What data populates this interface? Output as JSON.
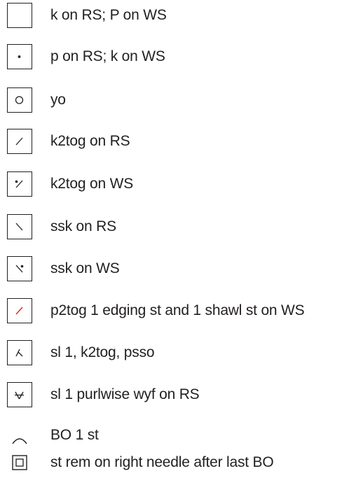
{
  "legend": {
    "items": [
      {
        "symbol": "blank-square-icon",
        "label": "k on RS; P on WS"
      },
      {
        "symbol": "dot-icon",
        "label": "p on RS; k on WS"
      },
      {
        "symbol": "circle-icon",
        "label": "yo"
      },
      {
        "symbol": "right-slant-icon",
        "label": "k2tog on RS"
      },
      {
        "symbol": "right-slant-dot-icon",
        "label": "k2tog on WS"
      },
      {
        "symbol": "left-slant-icon",
        "label": "ssk on RS"
      },
      {
        "symbol": "left-slant-dot-icon",
        "label": "ssk on WS"
      },
      {
        "symbol": "red-right-slant-icon",
        "label": "p2tog 1 edging st and 1 shawl st on WS"
      },
      {
        "symbol": "double-decrease-icon",
        "label": "sl 1, k2tog, psso"
      },
      {
        "symbol": "slip-wyf-icon",
        "label": "sl 1 purlwise wyf on RS"
      },
      {
        "symbol": "bind-off-arc-icon",
        "label": "BO 1 st"
      },
      {
        "symbol": "nested-square-icon",
        "label": "st rem on right needle after last BO"
      }
    ],
    "colors": {
      "ink": "#231f20",
      "red_symbol": "#e2231a"
    }
  }
}
